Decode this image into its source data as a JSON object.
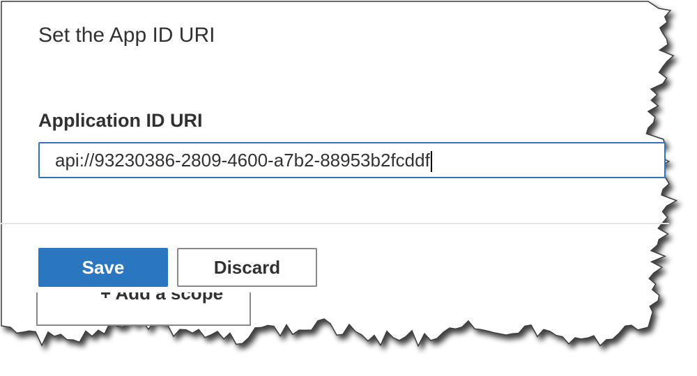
{
  "dialog": {
    "title": "Set the App ID URI",
    "field_label": "Application ID URI",
    "field_value": "api://93230386-2809-4600-a7b2-88953b2fcddf",
    "save_label": "Save",
    "discard_label": "Discard"
  },
  "background": {
    "partial_button_label": "+ Add a scope"
  },
  "colors": {
    "primary": "#2b76c1",
    "focus_border": "#2f74bd",
    "text": "#323130",
    "border": "#8a8886"
  }
}
